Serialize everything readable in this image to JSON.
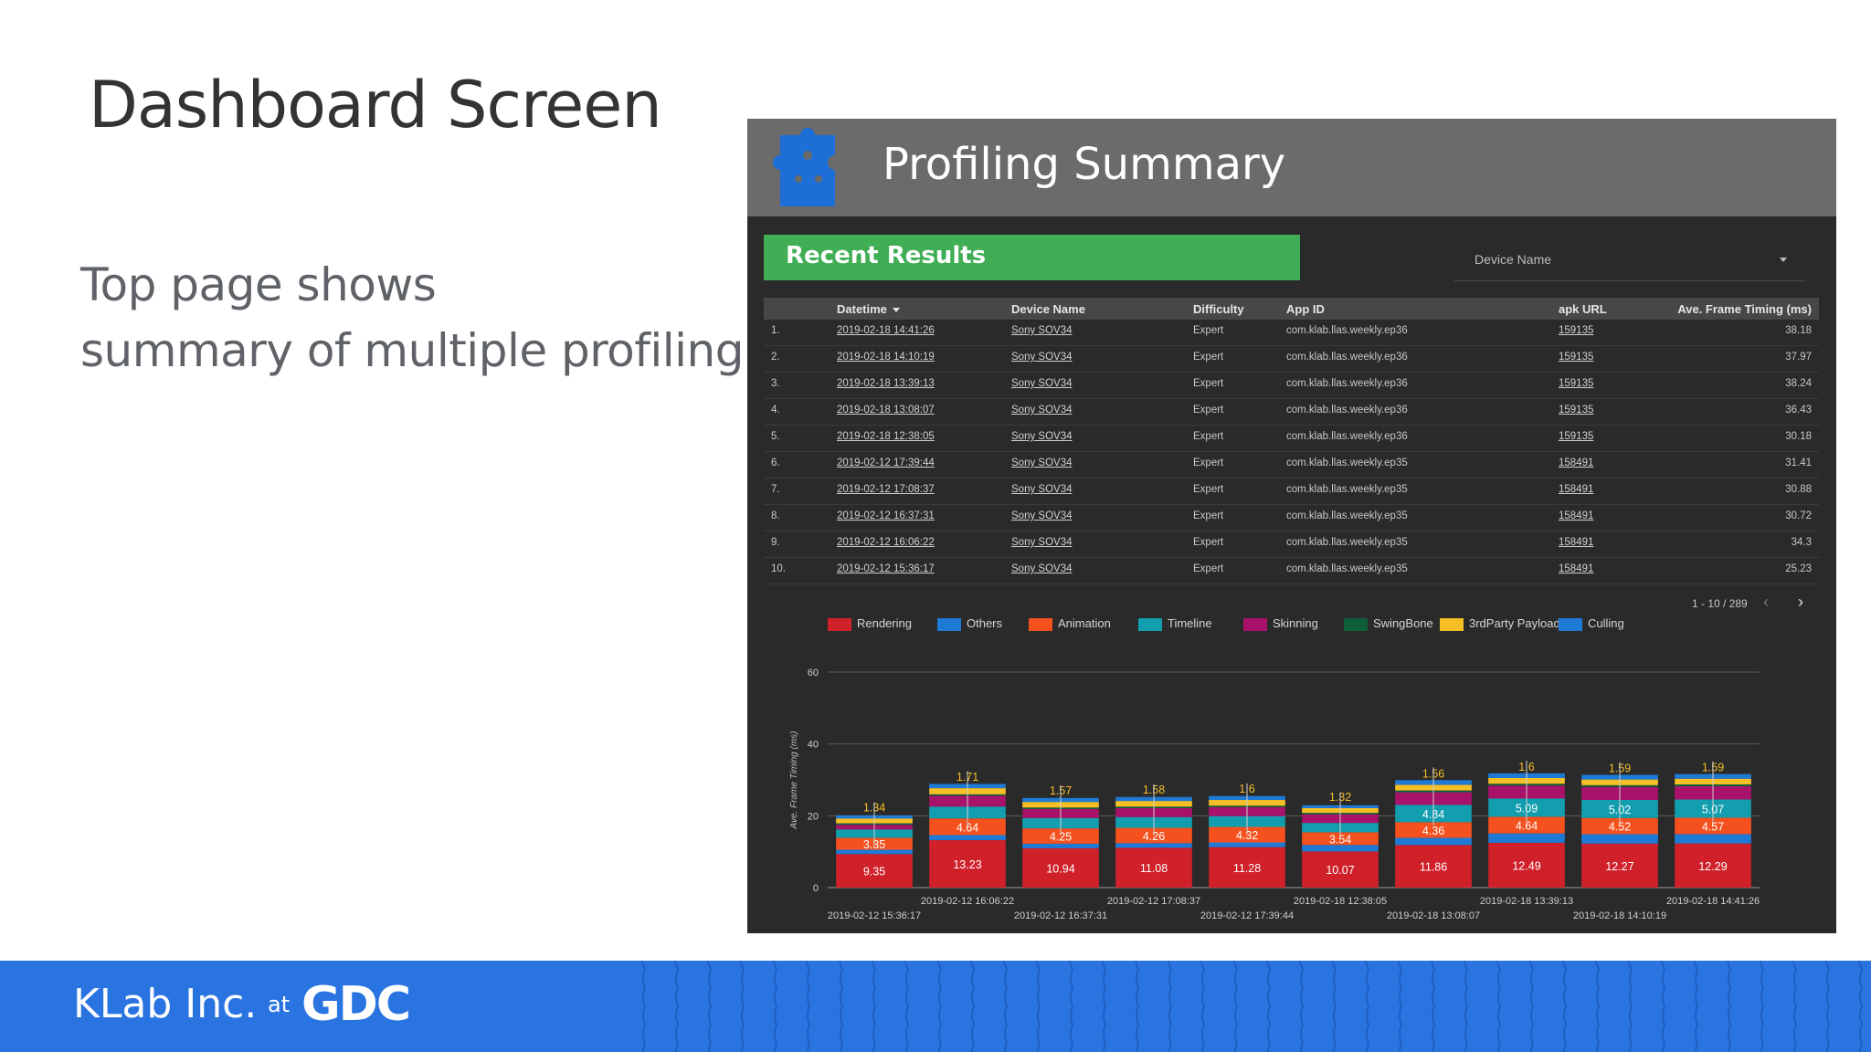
{
  "slide": {
    "title": "Dashboard Screen",
    "body_line1": "Top page shows",
    "body_line2": "summary of multiple profiling"
  },
  "dashboard": {
    "title": "Profiling Summary",
    "recent_label": "Recent Results",
    "device_select_label": "Device Name",
    "columns": [
      "",
      "Datetime",
      "Device Name",
      "Difficulty",
      "App ID",
      "apk URL",
      "Ave. Frame Timing (ms)"
    ],
    "rows": [
      {
        "num": "1.",
        "datetime": "2019-02-18 14:41:26",
        "device": "Sony SOV34",
        "difficulty": "Expert",
        "app_id": "com.klab.llas.weekly.ep36",
        "apk": "159135",
        "frame": "38.18"
      },
      {
        "num": "2.",
        "datetime": "2019-02-18 14:10:19",
        "device": "Sony SOV34",
        "difficulty": "Expert",
        "app_id": "com.klab.llas.weekly.ep36",
        "apk": "159135",
        "frame": "37.97"
      },
      {
        "num": "3.",
        "datetime": "2019-02-18 13:39:13",
        "device": "Sony SOV34",
        "difficulty": "Expert",
        "app_id": "com.klab.llas.weekly.ep36",
        "apk": "159135",
        "frame": "38.24"
      },
      {
        "num": "4.",
        "datetime": "2019-02-18 13:08:07",
        "device": "Sony SOV34",
        "difficulty": "Expert",
        "app_id": "com.klab.llas.weekly.ep36",
        "apk": "159135",
        "frame": "36.43"
      },
      {
        "num": "5.",
        "datetime": "2019-02-18 12:38:05",
        "device": "Sony SOV34",
        "difficulty": "Expert",
        "app_id": "com.klab.llas.weekly.ep36",
        "apk": "159135",
        "frame": "30.18"
      },
      {
        "num": "6.",
        "datetime": "2019-02-12 17:39:44",
        "device": "Sony SOV34",
        "difficulty": "Expert",
        "app_id": "com.klab.llas.weekly.ep35",
        "apk": "158491",
        "frame": "31.41"
      },
      {
        "num": "7.",
        "datetime": "2019-02-12 17:08:37",
        "device": "Sony SOV34",
        "difficulty": "Expert",
        "app_id": "com.klab.llas.weekly.ep35",
        "apk": "158491",
        "frame": "30.88"
      },
      {
        "num": "8.",
        "datetime": "2019-02-12 16:37:31",
        "device": "Sony SOV34",
        "difficulty": "Expert",
        "app_id": "com.klab.llas.weekly.ep35",
        "apk": "158491",
        "frame": "30.72"
      },
      {
        "num": "9.",
        "datetime": "2019-02-12 16:06:22",
        "device": "Sony SOV34",
        "difficulty": "Expert",
        "app_id": "com.klab.llas.weekly.ep35",
        "apk": "158491",
        "frame": "34.3"
      },
      {
        "num": "10.",
        "datetime": "2019-02-12 15:36:17",
        "device": "Sony SOV34",
        "difficulty": "Expert",
        "app_id": "com.klab.llas.weekly.ep35",
        "apk": "158491",
        "frame": "25.23"
      }
    ],
    "pager_text": "1 - 10 / 289",
    "pager_prev": "‹",
    "pager_next": "›"
  },
  "legend": [
    {
      "name": "Rendering",
      "color": "#d0202a"
    },
    {
      "name": "Others",
      "color": "#1f7ad6"
    },
    {
      "name": "Animation",
      "color": "#f4511e"
    },
    {
      "name": "Timeline",
      "color": "#129eaf"
    },
    {
      "name": "Skinning",
      "color": "#a8126a"
    },
    {
      "name": "SwingBone",
      "color": "#0f5e3a"
    },
    {
      "name": "3rdParty Payload",
      "color": "#f6bf26"
    },
    {
      "name": "Culling",
      "color": "#1f7ad6"
    }
  ],
  "chart_data": {
    "type": "bar",
    "stacked": true,
    "ylabel": "Ave. Frame Timing (ms)",
    "ylim": [
      0,
      60
    ],
    "yticks": [
      0,
      20,
      40,
      60
    ],
    "categories": [
      "2019-02-12 15:36:17",
      "2019-02-12 16:06:22",
      "2019-02-12 16:37:31",
      "2019-02-12 17:08:37",
      "2019-02-12 17:39:44",
      "2019-02-18 12:38:05",
      "2019-02-18 13:08:07",
      "2019-02-18 13:39:13",
      "2019-02-18 14:10:19",
      "2019-02-18 14:41:26"
    ],
    "series": [
      {
        "name": "Rendering",
        "color": "#d0202a",
        "values": [
          9.35,
          13.23,
          10.94,
          11.08,
          11.28,
          10.07,
          11.86,
          12.49,
          12.27,
          12.29
        ],
        "labels": [
          "9.35",
          "13.23",
          "10.94",
          "11.08",
          "11.28",
          "10.07",
          "11.86",
          "12.49",
          "12.27",
          "12.29"
        ]
      },
      {
        "name": "Others",
        "color": "#1f7ad6",
        "values": [
          1.2,
          1.4,
          1.3,
          1.3,
          1.3,
          1.8,
          2.0,
          2.6,
          2.6,
          2.6
        ],
        "labels": [
          "",
          "",
          "",
          "",
          "",
          "",
          "",
          "",
          "",
          ""
        ]
      },
      {
        "name": "Animation",
        "color": "#f4511e",
        "values": [
          3.35,
          4.64,
          4.25,
          4.26,
          4.32,
          3.54,
          4.36,
          4.64,
          4.52,
          4.57
        ],
        "labels": [
          "3.35",
          "4.64",
          "4.25",
          "4.26",
          "4.32",
          "3.54",
          "4.36",
          "4.64",
          "4.52",
          "4.57"
        ]
      },
      {
        "name": "Timeline",
        "color": "#129eaf",
        "values": [
          2.3,
          3.3,
          2.9,
          3.0,
          3.0,
          2.6,
          4.84,
          5.09,
          5.02,
          5.07
        ],
        "labels": [
          "",
          "",
          "",
          "",
          "",
          "",
          "4.84",
          "5.09",
          "5.02",
          "5.07"
        ]
      },
      {
        "name": "Skinning",
        "color": "#a8126a",
        "values": [
          1.3,
          3.0,
          2.5,
          2.5,
          2.5,
          2.4,
          3.5,
          3.6,
          3.6,
          3.7
        ],
        "labels": [
          "",
          "",
          "",
          "",
          "",
          "",
          "",
          "",
          "",
          ""
        ]
      },
      {
        "name": "SwingBone",
        "color": "#0f5e3a",
        "values": [
          0.4,
          0.4,
          0.4,
          0.4,
          0.4,
          0.4,
          0.5,
          0.5,
          0.5,
          0.5
        ],
        "labels": [
          "",
          "",
          "",
          "",
          "",
          "",
          "",
          "",
          "",
          ""
        ]
      },
      {
        "name": "3rdParty Payload",
        "color": "#f6bf26",
        "values": [
          1.34,
          1.71,
          1.57,
          1.58,
          1.6,
          1.32,
          1.56,
          1.6,
          1.59,
          1.59
        ],
        "labels": [
          "1.34",
          "1.71",
          "1.57",
          "1.58",
          "1.6",
          "1.32",
          "1.56",
          "1.6",
          "1.59",
          "1.59"
        ]
      },
      {
        "name": "Culling",
        "color": "#1f7ad6",
        "values": [
          0.9,
          1.2,
          1.1,
          1.1,
          1.1,
          0.8,
          1.3,
          1.3,
          1.3,
          1.3
        ],
        "labels": [
          "",
          "",
          "",
          "",
          "",
          "",
          "",
          "",
          "",
          ""
        ]
      }
    ]
  },
  "footer": {
    "brand": "KLab Inc.",
    "at": "at",
    "gdc": "GDC"
  }
}
